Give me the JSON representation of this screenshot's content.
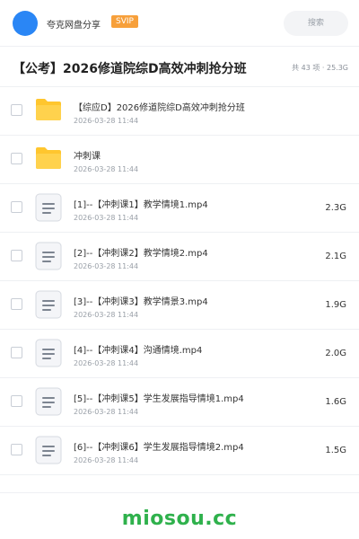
{
  "header": {
    "brand": "夸克网盘分享",
    "badge": "SVIP",
    "search_placeholder": "搜索"
  },
  "title_bar": {
    "title": "【公考】2026修道院综D高效冲刺抢分班",
    "meta": "共 43 项 · 25.3G"
  },
  "items": [
    {
      "type": "folder",
      "name": "【综应D】2026修道院综D高效冲刺抢分班",
      "date": "2026-03-28 11:44",
      "size": ""
    },
    {
      "type": "folder",
      "name": "冲刺课",
      "date": "2026-03-28 11:44",
      "size": ""
    },
    {
      "type": "file",
      "name": "[1]--【冲刺课1】教学情境1.mp4",
      "date": "2026-03-28 11:44",
      "size": "2.3G"
    },
    {
      "type": "file",
      "name": "[2]--【冲刺课2】教学情境2.mp4",
      "date": "2026-03-28 11:44",
      "size": "2.1G"
    },
    {
      "type": "file",
      "name": "[3]--【冲刺课3】教学情景3.mp4",
      "date": "2026-03-28 11:44",
      "size": "1.9G"
    },
    {
      "type": "file",
      "name": "[4]--【冲刺课4】沟通情境.mp4",
      "date": "2026-03-28 11:44",
      "size": "2.0G"
    },
    {
      "type": "file",
      "name": "[5]--【冲刺课5】学生发展指导情境1.mp4",
      "date": "2026-03-28 11:44",
      "size": "1.6G"
    },
    {
      "type": "file",
      "name": "[6]--【冲刺课6】学生发展指导情境2.mp4",
      "date": "2026-03-28 11:44",
      "size": "1.5G"
    }
  ],
  "footer": {
    "watermark": "miosou.cc"
  },
  "colors": {
    "accent": "#2a86f5",
    "svip": "#f7a03b",
    "folder": "#ffc62e",
    "watermark": "#2fb14c"
  }
}
